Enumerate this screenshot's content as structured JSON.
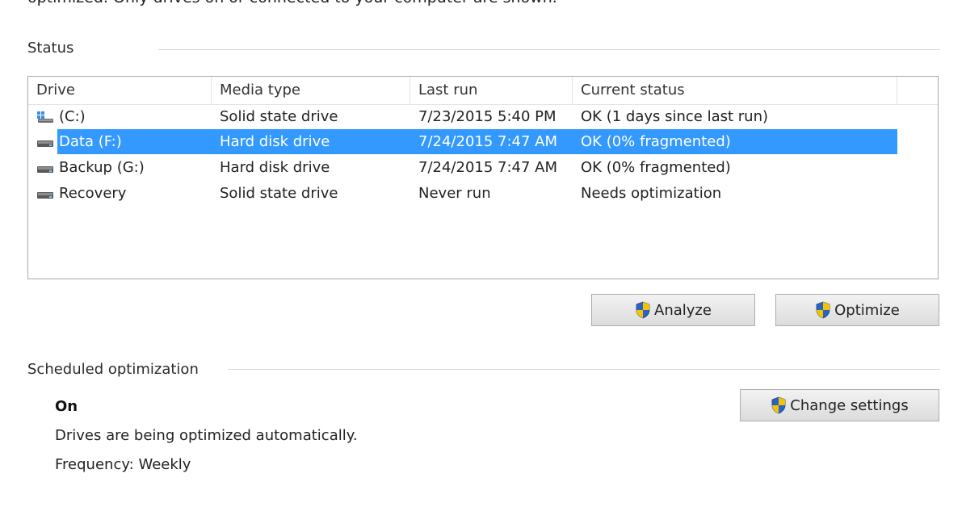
{
  "intro_text": "optimized. Only drives on or connected to your computer are shown.",
  "status": {
    "label": "Status",
    "columns": [
      "Drive",
      "Media type",
      "Last run",
      "Current status"
    ],
    "rows": [
      {
        "drive": "(C:)",
        "media": "Solid state drive",
        "last_run": "7/23/2015 5:40 PM",
        "status": "OK (1 days since last run)",
        "icon": "windows-drive-icon",
        "selected": false
      },
      {
        "drive": "Data (F:)",
        "media": "Hard disk drive",
        "last_run": "7/24/2015 7:47 AM",
        "status": "OK (0% fragmented)",
        "icon": "hard-drive-icon",
        "selected": true
      },
      {
        "drive": "Backup (G:)",
        "media": "Hard disk drive",
        "last_run": "7/24/2015 7:47 AM",
        "status": "OK (0% fragmented)",
        "icon": "hard-drive-icon",
        "selected": false
      },
      {
        "drive": "Recovery",
        "media": "Solid state drive",
        "last_run": "Never run",
        "status": "Needs optimization",
        "icon": "hard-drive-icon",
        "selected": false
      }
    ]
  },
  "buttons": {
    "analyze": "Analyze",
    "optimize": "Optimize",
    "change_settings": "Change settings"
  },
  "scheduled": {
    "label": "Scheduled optimization",
    "state": "On",
    "description": "Drives are being optimized automatically.",
    "frequency": "Frequency: Weekly"
  },
  "colors": {
    "selection": "#3399ff",
    "shield_blue": "#2a63c8",
    "shield_yellow": "#f5c400"
  }
}
